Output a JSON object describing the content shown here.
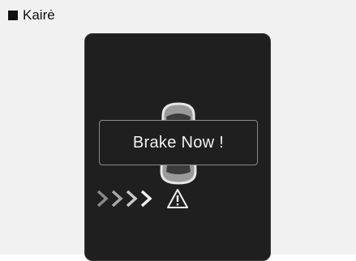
{
  "heading": {
    "bullet_icon": "square-bullet-icon",
    "label": "Kairė"
  },
  "display": {
    "alert_text": "Brake Now !",
    "icons": {
      "vehicle": "car-top-view-icon",
      "approach": "chevron-arrows-icon",
      "warning": "warning-triangle-icon"
    }
  },
  "colors": {
    "display_bg": "#1f1f1f",
    "alert_border": "#8a8a8a",
    "text": "#f2f2f2"
  }
}
